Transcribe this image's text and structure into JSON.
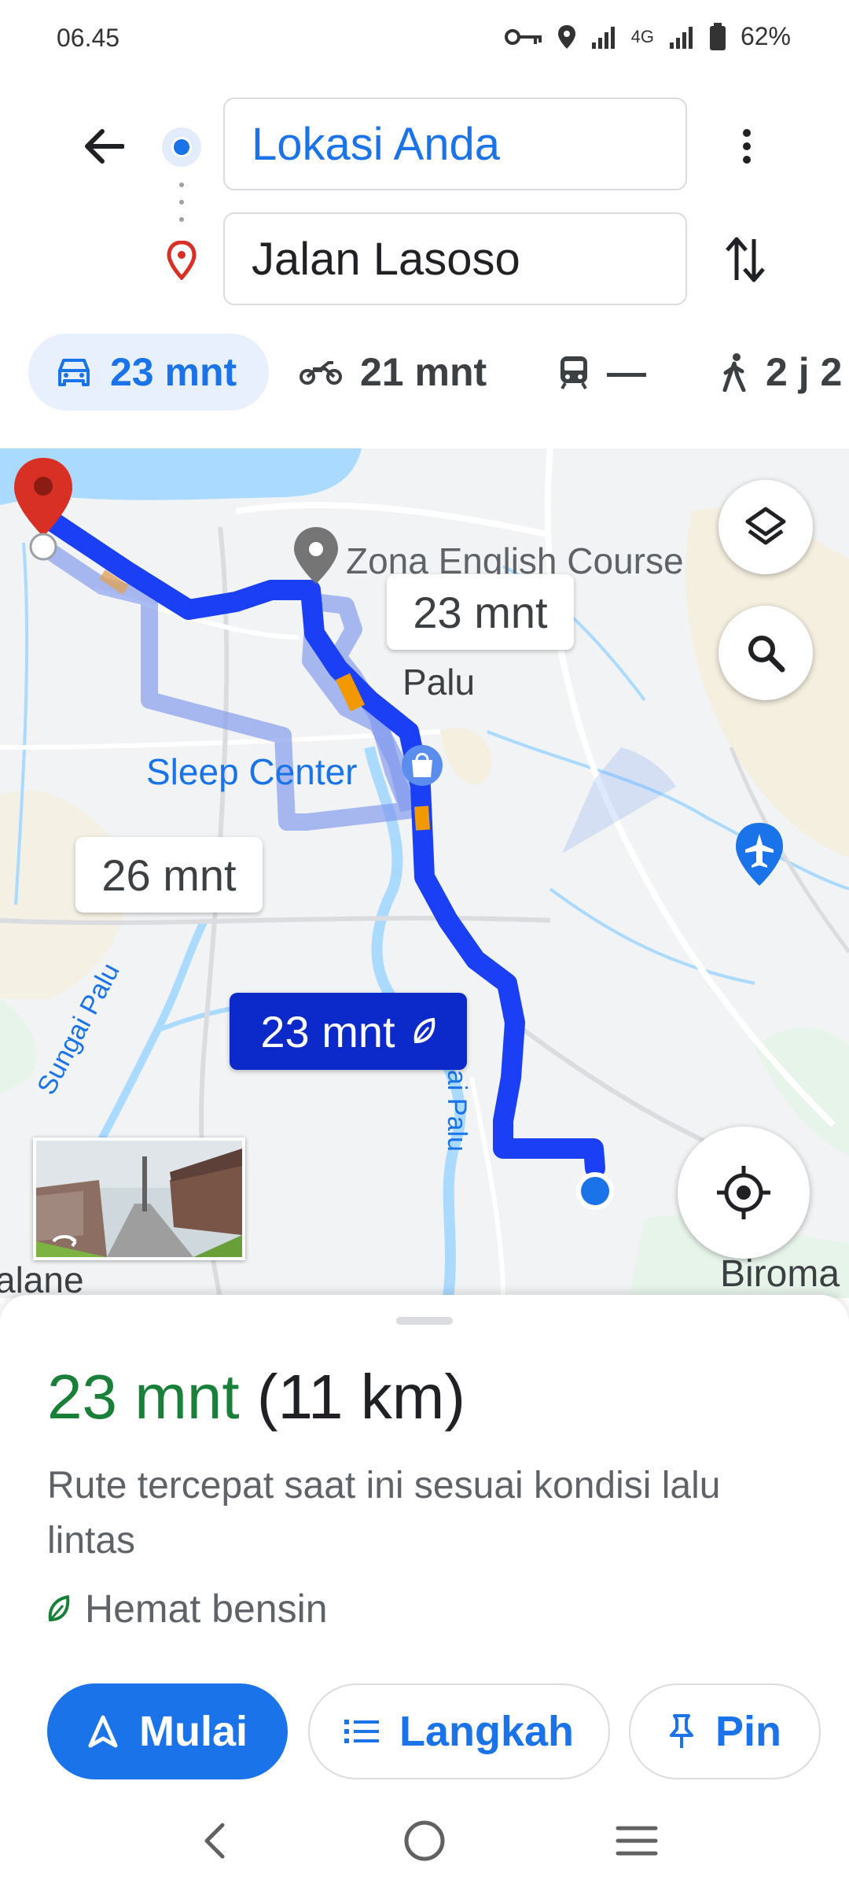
{
  "status_bar": {
    "time": "06.45",
    "network": "4G",
    "battery": "62%",
    "icons": [
      "vpn-key-icon",
      "location-icon",
      "signal-icon",
      "signal-icon",
      "battery-icon"
    ]
  },
  "header": {
    "origin": "Lokasi Anda",
    "destination": "Jalan Lasoso",
    "icons": [
      "back-arrow-icon",
      "origin-dot-icon",
      "destination-pin-icon",
      "more-vert-icon",
      "swap-icon"
    ]
  },
  "modes": [
    {
      "icon": "car-icon",
      "label": "23 mnt",
      "active": true
    },
    {
      "icon": "motorcycle-icon",
      "label": "21 mnt",
      "active": false
    },
    {
      "icon": "transit-icon",
      "label": "—",
      "active": false
    },
    {
      "icon": "walk-icon",
      "label": "2 j 2",
      "active": false
    }
  ],
  "map": {
    "labels": {
      "zona": "Zona English Course",
      "palu": "Palu",
      "sleep": "Sleep Center",
      "river_left": "Sungai Palu",
      "river_center": "ai Palu",
      "left_edge": "alane",
      "right_edge": "Biroma"
    },
    "chips": {
      "alt1": "23 mnt",
      "alt2": "26 mnt",
      "primary": "23 mnt"
    },
    "colors": {
      "route": "#1a3ff5",
      "alt_route": "#a6b8f2",
      "traffic": "#f29900",
      "water": "#aadaff",
      "land": "#f1f3f4"
    }
  },
  "route": {
    "time": "23 mnt",
    "distance": "(11 km)",
    "description": "Rute tercepat saat ini sesuai kondisi lalu lintas",
    "eco": "Hemat bensin"
  },
  "actions": {
    "start": "Mulai",
    "steps": "Langkah",
    "pin": "Pin"
  }
}
